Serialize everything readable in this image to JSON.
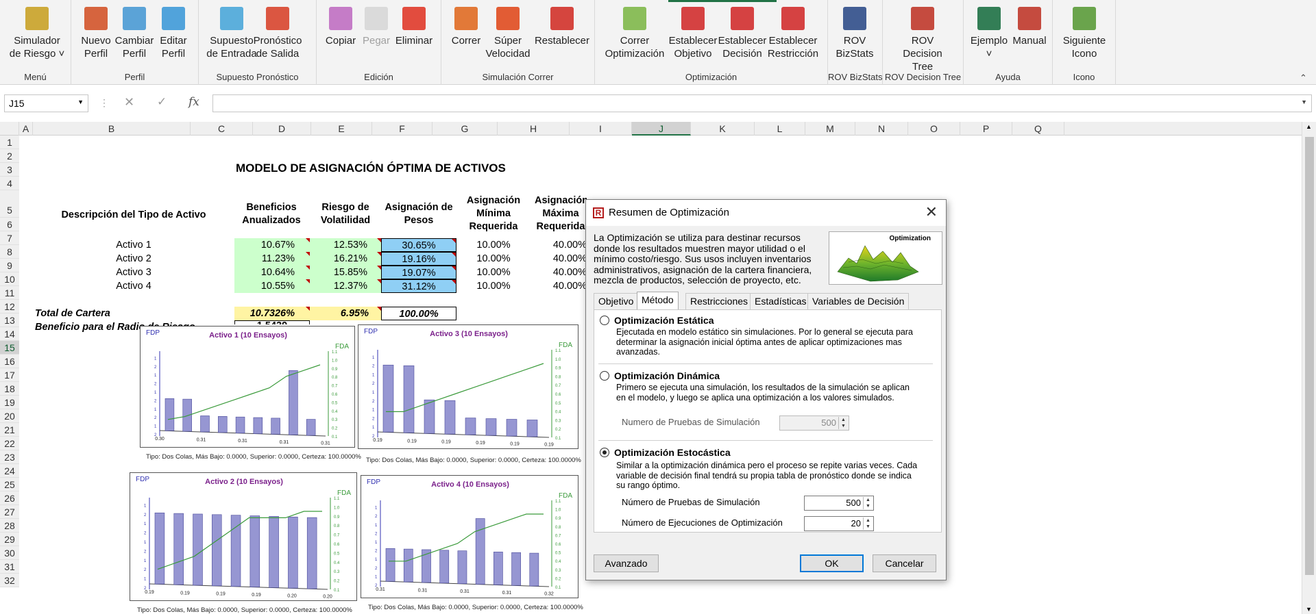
{
  "ribbon": {
    "groups": [
      {
        "label": "Menú",
        "buttons": [
          {
            "label": "Simulador\nde Riesgo ˅",
            "icon": "simulator-icon"
          }
        ]
      },
      {
        "label": "Perfil",
        "buttons": [
          {
            "label": "Nuevo\nPerfil",
            "icon": "new-profile-icon"
          },
          {
            "label": "Cambiar\nPerfil",
            "icon": "change-profile-icon"
          },
          {
            "label": "Editar\nPerfil",
            "icon": "edit-profile-icon"
          }
        ]
      },
      {
        "label": "Supuesto  Pronóstico",
        "buttons": [
          {
            "label": "Supuesto\nde Entrada",
            "icon": "input-assumption-icon"
          },
          {
            "label": "Pronóstico\nde Salida",
            "icon": "output-forecast-icon"
          }
        ]
      },
      {
        "label": "Edición",
        "buttons": [
          {
            "label": "Copiar",
            "icon": "copy-icon"
          },
          {
            "label": "Pegar",
            "icon": "paste-icon",
            "disabled": true
          },
          {
            "label": "Eliminar",
            "icon": "delete-icon"
          }
        ]
      },
      {
        "label": "Simulación Correr",
        "buttons": [
          {
            "label": "Correr",
            "icon": "run-icon"
          },
          {
            "label": "Súper\nVelocidad",
            "icon": "super-speed-icon"
          },
          {
            "label": "Restablecer",
            "icon": "reset-icon"
          }
        ]
      },
      {
        "label": "Optimización",
        "buttons": [
          {
            "label": "Correr\nOptimización",
            "icon": "run-optimization-icon"
          },
          {
            "label": "Establecer\nObjetivo",
            "icon": "set-objective-icon"
          },
          {
            "label": "Establecer\nDecisión",
            "icon": "set-decision-icon"
          },
          {
            "label": "Establecer\nRestricción",
            "icon": "set-constraint-icon"
          }
        ]
      },
      {
        "label": "ROV BizStats",
        "buttons": [
          {
            "label": "ROV\nBizStats",
            "icon": "bizstats-icon"
          }
        ]
      },
      {
        "label": "ROV Decision Tree",
        "buttons": [
          {
            "label": "ROV\nDecision Tree",
            "icon": "decision-tree-icon"
          }
        ]
      },
      {
        "label": "Ayuda",
        "buttons": [
          {
            "label": "Ejemplo\n˅",
            "icon": "example-icon"
          },
          {
            "label": "Manual",
            "icon": "manual-pdf-icon"
          }
        ]
      },
      {
        "label": "Icono",
        "buttons": [
          {
            "label": "Siguiente\nIcono",
            "icon": "next-icon-gear-icon"
          }
        ]
      }
    ]
  },
  "formula_bar": {
    "name_box": "J15",
    "formula": ""
  },
  "columns": [
    "A",
    "B",
    "C",
    "D",
    "E",
    "F",
    "G",
    "H",
    "I",
    "J",
    "K",
    "L",
    "M",
    "N",
    "O",
    "P",
    "Q"
  ],
  "rows": [
    "1",
    "2",
    "3",
    "4",
    "5",
    "6",
    "7",
    "8",
    "9",
    "10",
    "11",
    "12",
    "13",
    "14",
    "15",
    "16",
    "17",
    "18",
    "19",
    "20",
    "21",
    "22",
    "23",
    "24",
    "25",
    "26",
    "27",
    "28",
    "29",
    "30",
    "31",
    "32"
  ],
  "selected": {
    "column": "J",
    "row": "15"
  },
  "sheet": {
    "title": "MODELO DE ASIGNACIÓN ÓPTIMA DE ACTIVOS",
    "headers": {
      "desc": "Descripción del Tipo de Activo",
      "beneficios": "Beneficios Anualizados",
      "riesgo": "Riesgo de Volatilidad",
      "asignacion": "Asignación de Pesos",
      "minima": "Asignación Mínima Requerida",
      "maxima": "Asignación Máxima Requerida"
    },
    "assets": [
      {
        "name": "Activo 1",
        "beneficio": "10.67%",
        "riesgo": "12.53%",
        "peso": "30.65%",
        "min": "10.00%",
        "max": "40.00%"
      },
      {
        "name": "Activo  2",
        "beneficio": "11.23%",
        "riesgo": "16.21%",
        "peso": "19.16%",
        "min": "10.00%",
        "max": "40.00%"
      },
      {
        "name": "Activo 3",
        "beneficio": "10.64%",
        "riesgo": "15.85%",
        "peso": "19.07%",
        "min": "10.00%",
        "max": "40.00%"
      },
      {
        "name": "Activo 4",
        "beneficio": "10.55%",
        "riesgo": "12.37%",
        "peso": "31.12%",
        "min": "10.00%",
        "max": "40.00%"
      }
    ],
    "total": {
      "label": "Total de Cartera",
      "beneficio": "10.7326%",
      "riesgo": "6.95%",
      "peso": "100.00%"
    },
    "ratio_label": "Beneficio para el Radio de Riesgo",
    "ratio_value": "1.5439"
  },
  "charts": [
    {
      "title": "Activo 1 (10 Ensayos)",
      "pdf": "FDP",
      "cdf": "FDA",
      "caption": "Tipo: Dos Colas, Más Bajo: 0.0000, Superior: 0.0000, Certeza: 100.0000%",
      "x_ticks": [
        "0.30",
        "0.31",
        "0.31",
        "0.31",
        "0.31"
      ],
      "bars": [
        1,
        1,
        0.5,
        0.5,
        0.5,
        0.5,
        0.5,
        2,
        0.5
      ],
      "cdf_values": [
        0.05,
        0.1,
        0.2,
        0.3,
        0.4,
        0.5,
        0.6,
        0.8,
        0.9,
        1.0
      ]
    },
    {
      "title": "Activo 3 (10 Ensayos)",
      "pdf": "FDP",
      "cdf": "FDA",
      "caption": "Tipo: Dos Colas, Más Bajo: 0.0000, Superior: 0.0000, Certeza: 100.0000%",
      "x_ticks": [
        "0.19",
        "0.19",
        "0.19",
        "0.19",
        "0.19",
        "0.19"
      ],
      "bars": [
        2,
        2,
        1,
        1,
        0.5,
        0.5,
        0.5,
        0.5
      ],
      "cdf_values": [
        0.2,
        0.2,
        0.3,
        0.4,
        0.5,
        0.6,
        0.7,
        0.8,
        0.9,
        1.0
      ]
    },
    {
      "title": "Activo  2 (10 Ensayos)",
      "pdf": "FDP",
      "cdf": "FDA",
      "caption": "Tipo: Dos Colas, Más Bajo: 0.0000, Superior: 0.0000, Certeza: 100.0000%",
      "x_ticks": [
        "0.19",
        "0.19",
        "0.19",
        "0.19",
        "0.20",
        "0.20"
      ],
      "bars": [
        1,
        1,
        1,
        1,
        1,
        1,
        1,
        1,
        1
      ],
      "cdf_values": [
        0.1,
        0.2,
        0.3,
        0.5,
        0.7,
        0.9,
        0.9,
        0.9,
        1.0,
        1.0
      ]
    },
    {
      "title": "Activo 4 (10 Ensayos)",
      "pdf": "FDP",
      "cdf": "FDA",
      "caption": "Tipo: Dos Colas, Más Bajo: 0.0000, Superior: 0.0000, Certeza: 100.0000%",
      "x_ticks": [
        "0.31",
        "0.31",
        "0.31",
        "0.31",
        "0.32"
      ],
      "bars": [
        1,
        1,
        1,
        1,
        1,
        2,
        1,
        1,
        1
      ],
      "cdf_values": [
        0.2,
        0.2,
        0.3,
        0.4,
        0.5,
        0.7,
        0.8,
        0.9,
        1.0,
        1.0
      ]
    }
  ],
  "dialog": {
    "title": "Resumen de Optimización",
    "description": "La Optimización se utiliza para destinar recursos donde los resultados muestren mayor utilidad o el mínimo costo/riesgo. Sus usos incluyen inventarios administrativos, asignación de la cartera financiera, mezcla de productos, selección de proyecto, etc.",
    "image_label": "Optimization",
    "tabs": [
      "Objetivo",
      "Método",
      "Restricciones",
      "Estadísticas",
      "Variables de Decisión"
    ],
    "active_tab": "Método",
    "options": [
      {
        "label": "Optimización Estática",
        "desc": "Ejecutada en modelo estático sin simulaciones. Por lo general se ejecuta para determinar la asignación inicial óptima antes de aplicar optimizaciones mas avanzadas.",
        "selected": false
      },
      {
        "label": "Optimización Dinámica",
        "desc": "Primero se ejecuta una simulación, los resultados de la simulación se aplican en el modelo, y luego se aplica una optimización a los valores simulados.",
        "selected": false
      },
      {
        "label": "Optimización Estocástica",
        "desc": "Similar a la optimización dinámica pero el proceso se repite varias veces. Cada variable de decisión final tendrá su propia tabla de pronóstico donde se indica su rango óptimo.",
        "selected": true
      }
    ],
    "dynamic_trials_label": "Numero de Pruebas de Simulación",
    "dynamic_trials_value": "500",
    "stoch_trials_label": "Número de Pruebas de Simulación",
    "stoch_trials_value": "500",
    "stoch_runs_label": "Número de Ejecuciones de Optimización",
    "stoch_runs_value": "20",
    "buttons": {
      "advanced": "Avanzado",
      "ok": "OK",
      "cancel": "Cancelar"
    }
  },
  "colors": {
    "accent": "#217346",
    "green_cell": "#ccffcc",
    "blue_cell": "#8fcff5",
    "yellow_cell": "#fff4a3",
    "bar": "#9696d2",
    "cdf_line": "#3a9a3a",
    "title_purple": "#7a1f8a"
  }
}
